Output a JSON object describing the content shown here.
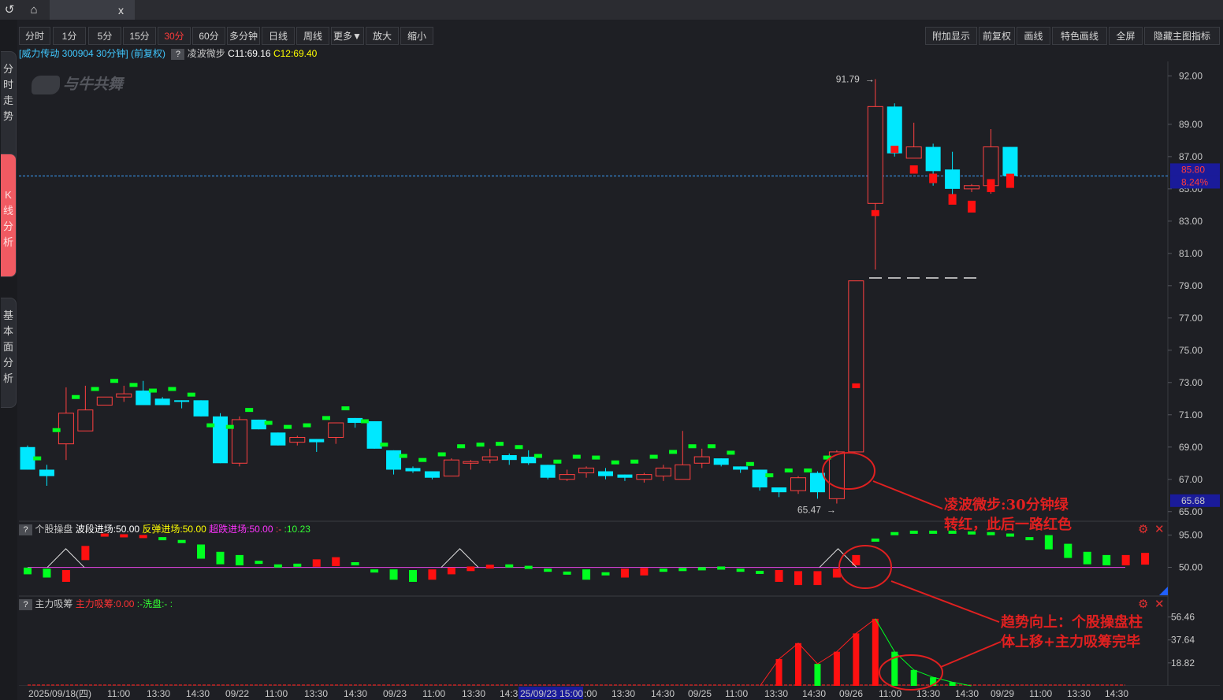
{
  "titlebar": {
    "back_glyph": "↺",
    "home_glyph": "⌂",
    "tab_title": "",
    "close_glyph": "x"
  },
  "sidebar": {
    "tabs": [
      {
        "label": "分时走势",
        "active": false
      },
      {
        "label": "K线分析",
        "active": true
      },
      {
        "label": "基本面分析",
        "active": false
      }
    ]
  },
  "toolbar": {
    "periods": [
      "分时",
      "1分",
      "5分",
      "15分",
      "30分",
      "60分",
      "多分钟",
      "日线",
      "周线",
      "更多▼",
      "放大",
      "缩小"
    ],
    "selected_period": "30分",
    "right_buttons": [
      "附加显示",
      "前复权",
      "画线",
      "特色画线",
      "全屏",
      "隐藏主图指标"
    ]
  },
  "main_info": {
    "stock_label": "[威力传动 300904 30分钟] (前复权)",
    "help_glyph": "?",
    "indicator_name": "凌波微步",
    "c11": "C11:69.16",
    "c12": "C12:69.40"
  },
  "watermark": "与牛共舞",
  "chart_data": {
    "type": "candlestick",
    "price_axis_ticks": [
      "92.00",
      "89.00",
      "87.00",
      "85.00",
      "83.00",
      "81.00",
      "79.00",
      "77.00",
      "75.00",
      "73.00",
      "71.00",
      "69.00",
      "67.00",
      "65.00"
    ],
    "price_range": [
      64.5,
      92.8
    ],
    "current_price": "85.80",
    "current_change": "8.24%",
    "low_marker_value": "65.68",
    "high_label": "91.79",
    "low_label": "65.47",
    "time_axis_labels": [
      "2025/09/18(四)",
      "11:00",
      "13:30",
      "14:30",
      "09/22",
      "11:00",
      "13:30",
      "14:30",
      "09/23",
      "11:00",
      "13:30",
      "14:3",
      "25/09/23 15:00",
      ":00",
      "13:30",
      "14:30",
      "09/25",
      "11:00",
      "13:30",
      "14:30",
      "09/26",
      "11:00",
      "13:30",
      "14:30",
      "09/29",
      "11:00",
      "13:30",
      "14:30"
    ],
    "candles": [
      [
        69.0,
        67.6,
        69.1,
        67.6
      ],
      [
        67.6,
        67.2,
        67.9,
        66.6
      ],
      [
        69.2,
        71.1,
        72.7,
        68.2
      ],
      [
        70.0,
        71.3,
        72.8,
        70.0
      ],
      [
        71.6,
        72.1,
        72.1,
        71.6
      ],
      [
        72.1,
        72.3,
        72.8,
        71.8
      ],
      [
        72.5,
        71.6,
        73.1,
        71.6
      ],
      [
        72.0,
        71.6,
        72.1,
        71.6
      ],
      [
        71.9,
        71.8,
        71.9,
        71.4
      ],
      [
        71.9,
        70.9,
        71.9,
        70.9
      ],
      [
        70.9,
        68.0,
        71.1,
        68.0
      ],
      [
        68.0,
        70.7,
        70.9,
        67.8
      ],
      [
        70.7,
        70.1,
        70.7,
        70.1
      ],
      [
        69.9,
        69.1,
        69.9,
        69.1
      ],
      [
        69.3,
        69.6,
        69.7,
        69.1
      ],
      [
        69.5,
        69.3,
        69.5,
        68.7
      ],
      [
        69.6,
        70.5,
        70.5,
        69.2
      ],
      [
        70.8,
        70.5,
        70.8,
        70.2
      ],
      [
        70.6,
        68.9,
        70.6,
        68.9
      ],
      [
        68.8,
        67.6,
        68.8,
        67.3
      ],
      [
        67.7,
        67.5,
        67.8,
        67.4
      ],
      [
        67.5,
        67.1,
        67.5,
        67.0
      ],
      [
        67.2,
        68.2,
        68.3,
        67.2
      ],
      [
        68.0,
        68.1,
        68.2,
        67.6
      ],
      [
        68.2,
        68.4,
        68.9,
        68.0
      ],
      [
        68.5,
        68.2,
        68.6,
        67.9
      ],
      [
        68.4,
        68.0,
        68.8,
        67.9
      ],
      [
        67.9,
        67.1,
        67.9,
        67.0
      ],
      [
        67.0,
        67.3,
        67.6,
        66.9
      ],
      [
        67.4,
        67.7,
        67.8,
        67.1
      ],
      [
        67.5,
        67.2,
        67.7,
        67.0
      ],
      [
        67.3,
        67.1,
        67.3,
        66.9
      ],
      [
        67.0,
        67.3,
        67.4,
        66.8
      ],
      [
        67.2,
        67.7,
        67.9,
        66.9
      ],
      [
        67.0,
        67.9,
        70.0,
        67.0
      ],
      [
        68.0,
        68.4,
        68.9,
        67.7
      ],
      [
        68.3,
        67.9,
        68.3,
        67.8
      ],
      [
        67.8,
        67.6,
        67.8,
        67.4
      ],
      [
        67.6,
        66.5,
        67.6,
        66.3
      ],
      [
        66.5,
        66.2,
        66.5,
        65.9
      ],
      [
        66.3,
        67.1,
        67.2,
        66.1
      ],
      [
        67.4,
        66.2,
        67.5,
        65.8
      ],
      [
        65.8,
        68.7,
        68.8,
        65.5
      ],
      [
        68.7,
        79.3,
        79.3,
        68.7
      ],
      [
        84.1,
        90.1,
        91.8,
        80.0
      ],
      [
        90.1,
        87.2,
        90.3,
        87.0
      ],
      [
        86.9,
        87.6,
        89.1,
        86.9
      ],
      [
        87.6,
        86.1,
        87.8,
        85.2
      ],
      [
        86.2,
        85.0,
        87.3,
        84.6
      ],
      [
        85.0,
        85.2,
        85.3,
        84.8
      ],
      [
        85.2,
        87.6,
        88.7,
        84.7
      ],
      [
        87.6,
        85.8,
        87.6,
        85.3
      ]
    ],
    "indicator1": {
      "title": "个股操盘",
      "help_glyph": "?",
      "params": [
        {
          "text": "波段进场:50.00",
          "color": "#ffffff"
        },
        {
          "text": "反弹进场:50.00",
          "color": "#ffff00"
        },
        {
          "text": "超跌进场:50.00",
          "color": "#ff33ff"
        },
        {
          "text": ":-",
          "color": "#ff4444"
        },
        {
          "text": ":10.23",
          "color": "#33ff33"
        }
      ],
      "axis_ticks": [
        "95.00",
        "50.00"
      ],
      "baseline": 50,
      "range": [
        10,
        100
      ],
      "values": [
        45,
        42,
        38,
        70,
        95,
        94,
        93,
        90,
        86,
        72,
        63,
        60,
        57,
        52,
        53,
        56,
        58,
        55,
        45,
        40,
        38,
        40,
        45,
        48,
        51,
        52,
        50,
        46,
        42,
        40,
        41,
        42,
        44,
        46,
        47,
        48,
        49,
        46,
        43,
        38,
        35,
        35,
        42,
        60,
        88,
        97,
        99,
        99,
        99,
        98,
        97,
        95,
        90,
        85,
        73,
        63,
        60,
        60,
        62
      ],
      "colors": [
        "g",
        "g",
        "r",
        "r",
        "r",
        "r",
        "r",
        "g",
        "g",
        "g",
        "g",
        "g",
        "g",
        "g",
        "g",
        "r",
        "r",
        "g",
        "g",
        "g",
        "g",
        "r",
        "r",
        "r",
        "r",
        "g",
        "g",
        "g",
        "g",
        "g",
        "g",
        "r",
        "r",
        "g",
        "g",
        "g",
        "g",
        "g",
        "g",
        "r",
        "r",
        "r",
        "r",
        "r",
        "g",
        "g",
        "g",
        "g",
        "g",
        "g",
        "g",
        "g",
        "g",
        "g",
        "g",
        "g",
        "g",
        "r",
        "r"
      ]
    },
    "indicator2": {
      "title": "主力吸筹",
      "help_glyph": "?",
      "params": [
        {
          "text": "主力吸筹:0.00",
          "color": "#ff3333"
        },
        {
          "text": ":-洗盘:-",
          "color": "#33ff33"
        },
        {
          "text": ":",
          "color": "#33ff33"
        }
      ],
      "axis_ticks": [
        "56.46",
        "37.64",
        "18.82"
      ],
      "range": [
        0,
        62
      ],
      "bars": [
        {
          "slot": 39,
          "v": 22,
          "c": "r"
        },
        {
          "slot": 40,
          "v": 35,
          "c": "r"
        },
        {
          "slot": 41,
          "v": 18,
          "c": "g"
        },
        {
          "slot": 42,
          "v": 28,
          "c": "r"
        },
        {
          "slot": 43,
          "v": 43,
          "c": "r"
        },
        {
          "slot": 44,
          "v": 55,
          "c": "r"
        },
        {
          "slot": 45,
          "v": 28,
          "c": "g"
        },
        {
          "slot": 46,
          "v": 13,
          "c": "g"
        },
        {
          "slot": 47,
          "v": 7,
          "c": "g"
        },
        {
          "slot": 48,
          "v": 3,
          "c": "g"
        }
      ]
    }
  },
  "annotations": {
    "note1_line1": "凌波微步:30分钟绿",
    "note1_line2": "转红，此后一路红色",
    "note2_line1": "趋势向上：个股操盘柱",
    "note2_line2": "体上移+主力吸筹完毕"
  },
  "panel_controls": {
    "gear": "⚙",
    "close": "✕"
  }
}
